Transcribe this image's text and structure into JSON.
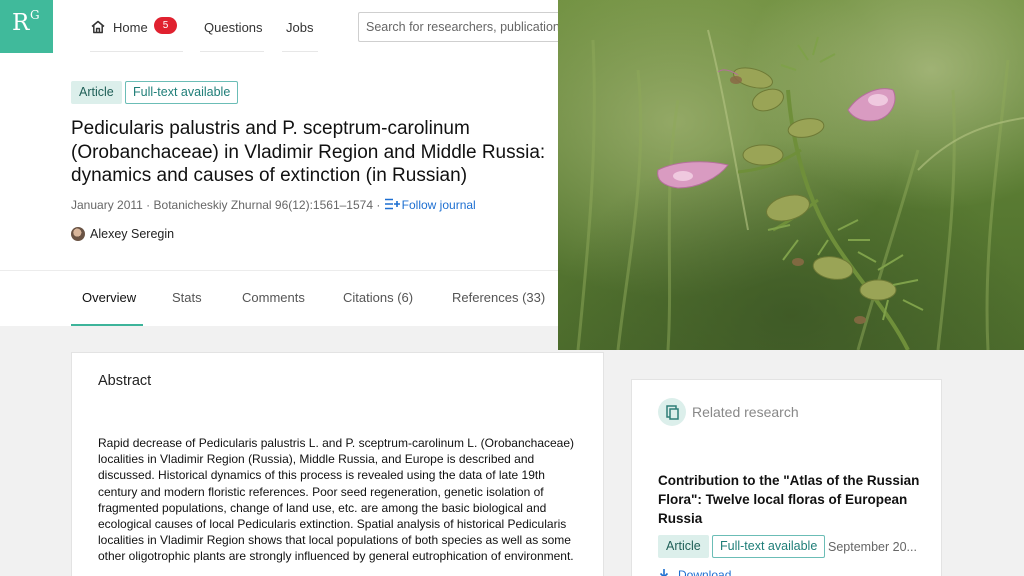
{
  "brand": {
    "logo_main": "R",
    "logo_sup": "G",
    "accent": "#40ba9b",
    "badge_color": "#e0212f",
    "link_color": "#1d6fd1"
  },
  "nav": {
    "home_label": "Home",
    "home_badge": "5",
    "questions_label": "Questions",
    "jobs_label": "Jobs",
    "search_placeholder": "Search for researchers, publications, and more"
  },
  "article": {
    "type_tag": "Article",
    "fulltext_tag": "Full-text available",
    "title": "Pedicularis palustris and P. sceptrum-carolinum (Orobanchaceae) in Vladimir Region and Middle Russia: dynamics and causes of extinction (in Russian)",
    "date": "January 2011",
    "separator": " · ",
    "journal": "Botanicheskiy Zhurnal 96(12):1561–1574",
    "follow_label": "Follow journal",
    "author": "Alexey Seregin"
  },
  "tabs": [
    {
      "label": "Overview",
      "active": true
    },
    {
      "label": "Stats"
    },
    {
      "label": "Comments"
    },
    {
      "label": "Citations (6)"
    },
    {
      "label": "References (33)"
    }
  ],
  "abstract": {
    "heading": "Abstract",
    "text": "Rapid decrease of Pedicularis palustris L. and P. sceptrum-carolinum L. (Orobanchaceae) localities in Vladimir Region (Russia), Middle Russia, and Europe is described and discussed. Historical dynamics of this process is revealed using the data of late 19th century and modern floristic references. Poor seed regeneration, genetic isolation of fragmented populations, change of land use, etc. are among the basic biological and ecological causes of local Pedicularis extinction. Spatial analysis of historical Pedicularis localities in Vladimir Region shows that local populations of both species as well as some other oligotrophic plants are strongly influenced by general eutrophication of environment."
  },
  "related": {
    "heading": "Related research",
    "title": "Contribution to the \"Atlas of the Russian Flora\": Twelve local floras of European Russia",
    "type_tag": "Article",
    "fulltext_tag": "Full-text available",
    "date": "September 20...",
    "download_label": "Download"
  },
  "icons": {
    "home": "house-icon",
    "follow": "follow-journal-icon",
    "related": "related-research-icon",
    "download": "download-icon"
  }
}
